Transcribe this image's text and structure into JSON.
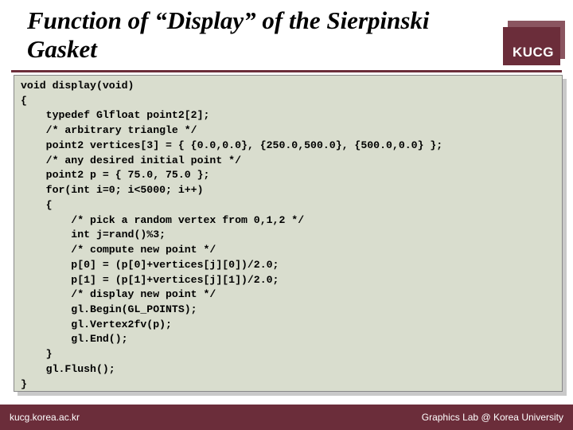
{
  "title": "Function of “Display” of the Sierpinski Gasket",
  "logo": "KUCG",
  "code": "void display(void)\n{\n    typedef Glfloat point2[2];\n    /* arbitrary triangle */\n    point2 vertices[3] = { {0.0,0.0}, {250.0,500.0}, {500.0,0.0} };\n    /* any desired initial point */\n    point2 p = { 75.0, 75.0 };\n    for(int i=0; i<5000; i++)\n    {\n        /* pick a random vertex from 0,1,2 */\n        int j=rand()%3;\n        /* compute new point */\n        p[0] = (p[0]+vertices[j][0])/2.0;\n        p[1] = (p[1]+vertices[j][1])/2.0;\n        /* display new point */\n        gl.Begin(GL_POINTS);\n        gl.Vertex2fv(p);\n        gl.End();\n    }\n    gl.Flush();\n}",
  "footer": {
    "left": "kucg.korea.ac.kr",
    "right": "Graphics Lab @ Korea University"
  }
}
